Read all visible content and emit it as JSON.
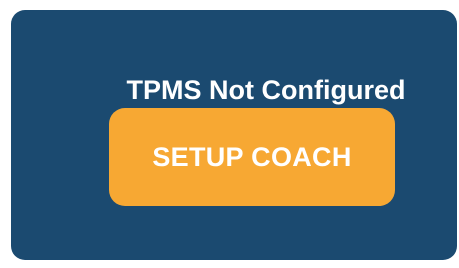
{
  "tpms_panel": {
    "status_text": "TPMS Not Configured",
    "setup_button_label": "SETUP COACH",
    "colors": {
      "panel_background": "#1b4a70",
      "button_background": "#f7a833",
      "text": "#ffffff"
    }
  }
}
